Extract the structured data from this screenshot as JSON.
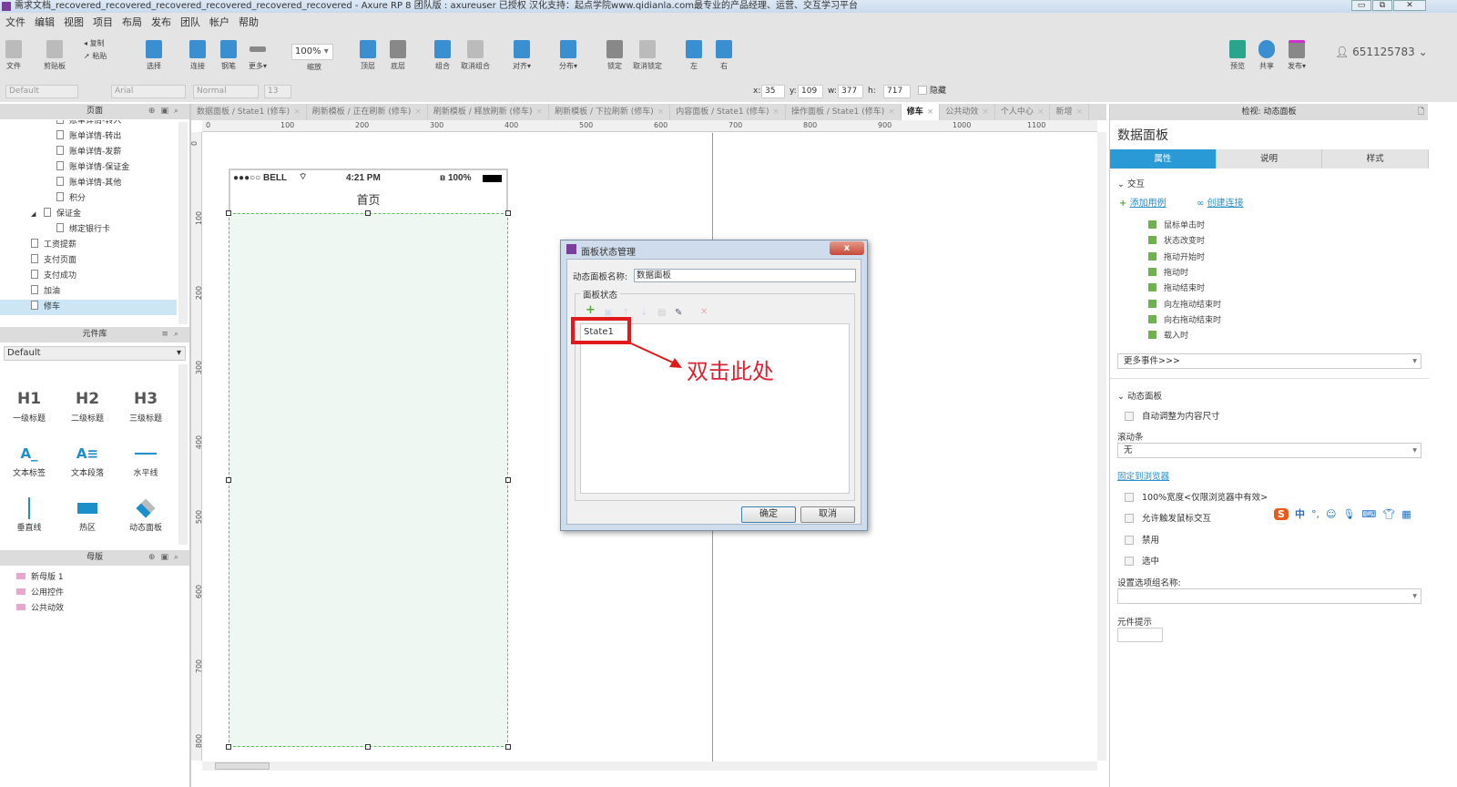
{
  "window": {
    "title": "需求文档_recovered_recovered_recovered_recovered_recovered_recovered - Axure RP 8 团队版 : axureuser 已授权 汉化支持：起点学院www.qidianla.com最专业的产品经理、运营、交互学习平台",
    "minimize": "▭",
    "restore": "⧉",
    "close": "✕"
  },
  "menu": [
    "文件",
    "编辑",
    "视图",
    "项目",
    "布局",
    "发布",
    "团队",
    "帐户",
    "帮助"
  ],
  "toolbar": {
    "file": "文件",
    "clipboard": "剪贴板",
    "copy": "复制",
    "paste": "粘贴",
    "select": "选择",
    "connect": "连接",
    "pen": "钢笔",
    "more": "更多▾",
    "zoom_value": "100%",
    "zoom_label": "缩放",
    "top": "顶层",
    "bottom": "底层",
    "group": "组合",
    "ungroup": "取消组合",
    "align": "对齐▾",
    "distribute": "分布▾",
    "lock": "锁定",
    "unlock": "取消锁定",
    "left": "左",
    "right": "右",
    "preview": "预览",
    "share": "共享",
    "publish": "发布▾",
    "user": "651125783"
  },
  "format": {
    "style": "Default",
    "font": "Arial",
    "weight": "Normal",
    "size": "13",
    "x_label": "x:",
    "x": "35",
    "y_label": "y:",
    "y": "109",
    "w_label": "w:",
    "w": "377",
    "h_label": "h:",
    "h": "717",
    "hidden_label": "隐藏"
  },
  "tabs": [
    {
      "label": "数据面板 / State1 (修车)"
    },
    {
      "label": "刷新模板 / 正在刷新 (修车)"
    },
    {
      "label": "刷新模板 / 释放刷新 (修车)"
    },
    {
      "label": "刷新模板 / 下拉刷新 (修车)"
    },
    {
      "label": "内容面板 / State1 (修车)"
    },
    {
      "label": "操作面板 / State1 (修车)"
    },
    {
      "label": "修车"
    },
    {
      "label": "公共动效"
    },
    {
      "label": "个人中心"
    },
    {
      "label": "新增"
    }
  ],
  "pages_panel": {
    "title": "页面",
    "items": [
      "账单详情-转入",
      "账单详情-转出",
      "账单详情-发薪",
      "账单详情-保证金",
      "账单详情-其他",
      "积分",
      "保证金",
      "绑定银行卡",
      "工资提薪",
      "支付页面",
      "支付成功",
      "加油",
      "修车"
    ]
  },
  "library": {
    "title": "元件库",
    "selected": "Default",
    "items": [
      {
        "glyph": "H1",
        "label": "一级标题"
      },
      {
        "glyph": "H2",
        "label": "二级标题"
      },
      {
        "glyph": "H3",
        "label": "三级标题"
      },
      {
        "glyph": "A_",
        "label": "文本标签"
      },
      {
        "glyph": "A≡",
        "label": "文本段落"
      },
      {
        "glyph": "",
        "label": "水平线"
      },
      {
        "glyph": "",
        "label": "垂直线"
      },
      {
        "glyph": "",
        "label": "热区"
      },
      {
        "glyph": "",
        "label": "动态面板"
      }
    ]
  },
  "masters": {
    "title": "母版",
    "items": [
      "新母版 1",
      "公用控件",
      "公共动效"
    ]
  },
  "ruler": {
    "h": [
      "0",
      "100",
      "200",
      "300",
      "400",
      "500",
      "600",
      "700",
      "800",
      "900",
      "1000",
      "1100"
    ],
    "v": [
      "0",
      "100",
      "200",
      "300",
      "400",
      "500",
      "600",
      "700",
      "800"
    ]
  },
  "phone": {
    "signal": "●●●○○ BELL",
    "time": "4:21 PM",
    "battery": "100%",
    "title": "首页"
  },
  "dialog": {
    "title": "面板状态管理",
    "name_label": "动态面板名称:",
    "name_value": "数据面板",
    "group_label": "面板状态",
    "state": "State1",
    "annotation": "双击此处",
    "ok": "确定",
    "cancel": "取消"
  },
  "inspector": {
    "header": "检视: 动态面板",
    "widget_name": "数据面板",
    "tabs": [
      "属性",
      "说明",
      "样式"
    ],
    "interaction_title": "交互",
    "add_case": "添加用例",
    "create_link": "创建连接",
    "events": [
      "鼠标单击时",
      "状态改变时",
      "拖动开始时",
      "拖动时",
      "拖动结束时",
      "向左拖动结束时",
      "向右拖动结束时",
      "载入时"
    ],
    "more_events": "更多事件>>>",
    "dp_title": "动态面板",
    "auto_fit": "自动调整为内容尺寸",
    "scroll_label": "滚动条",
    "scroll_value": "无",
    "pin": "固定到浏览器",
    "full_width": "100%宽度<仅限浏览器中有效>",
    "allow_mouse": "允许触发鼠标交互",
    "disabled": "禁用",
    "selected": "选中",
    "group_name": "设置选项组名称:",
    "tooltip": "元件提示"
  },
  "ime": {
    "label": "中"
  }
}
